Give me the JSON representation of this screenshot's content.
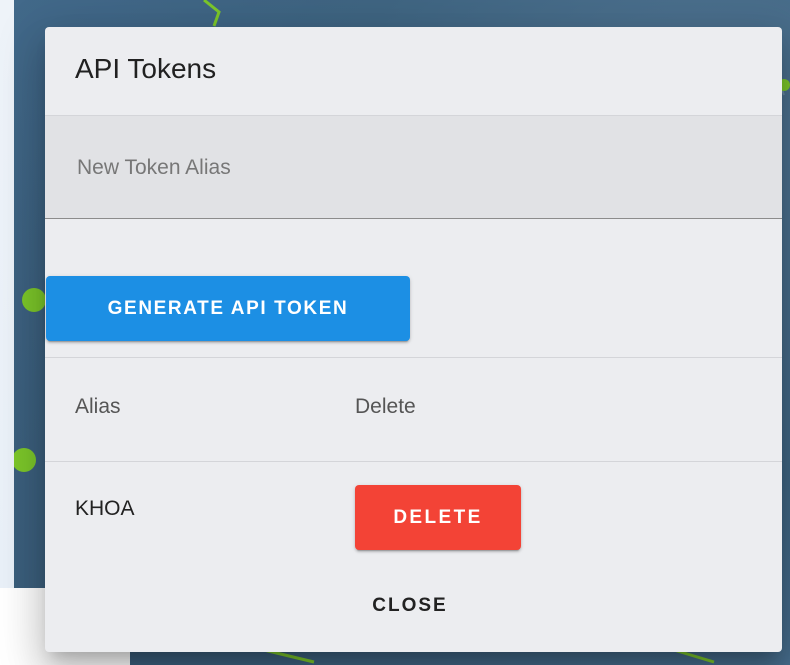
{
  "dialog": {
    "title": "API Tokens",
    "alias_input": {
      "placeholder": "New Token Alias",
      "value": ""
    },
    "generate_button": "GENERATE API TOKEN",
    "table": {
      "columns": [
        "Alias",
        "Delete"
      ],
      "rows": [
        {
          "alias": "KHOA",
          "delete_label": "DELETE"
        }
      ]
    },
    "close_button": "CLOSE"
  },
  "colors": {
    "primary_button": "#1c8fe4",
    "danger_button": "#f34336",
    "dialog_background": "#ecedf0",
    "map_background": "#42698a",
    "map_marker": "#7cc72a"
  }
}
